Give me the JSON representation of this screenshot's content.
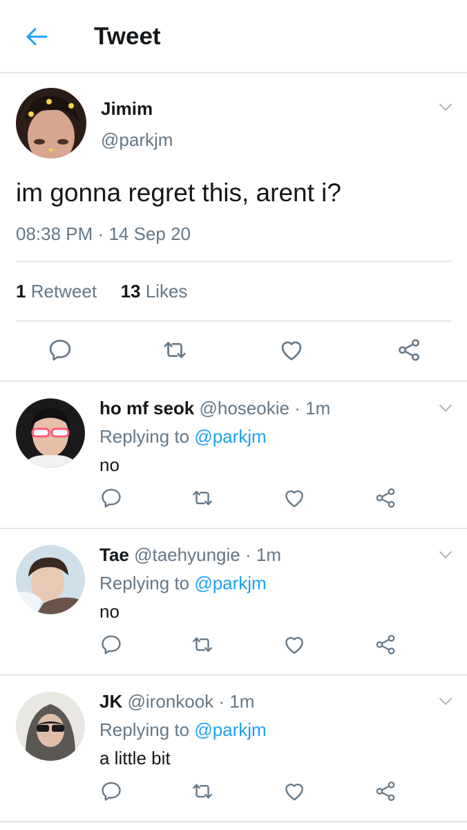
{
  "header": {
    "title": "Tweet",
    "back_icon": "arrow-left-icon"
  },
  "colors": {
    "accent": "#1da1f2",
    "secondary_text": "#657786",
    "primary_text": "#14171a",
    "divider": "#e1e6ea"
  },
  "main_tweet": {
    "name": "Jimim",
    "handle": "@parkjm",
    "text": "im gonna regret this, arent i?",
    "time": "08:38 PM",
    "separator": "·",
    "date": "14 Sep 20",
    "retweets_count": "1",
    "retweets_label": "Retweet",
    "likes_count": "13",
    "likes_label": "Likes"
  },
  "replies": [
    {
      "name": "ho mf seok",
      "handle": "@hoseokie",
      "separator": "·",
      "age": "1m",
      "replying_prefix": "Replying to",
      "replying_to": "@parkjm",
      "text": "no"
    },
    {
      "name": "Tae",
      "handle": "@taehyungie",
      "separator": "·",
      "age": "1m",
      "replying_prefix": "Replying to",
      "replying_to": "@parkjm",
      "text": "no"
    },
    {
      "name": "JK",
      "handle": "@ironkook",
      "separator": "·",
      "age": "1m",
      "replying_prefix": "Replying to",
      "replying_to": "@parkjm",
      "text": "a little bit"
    }
  ]
}
